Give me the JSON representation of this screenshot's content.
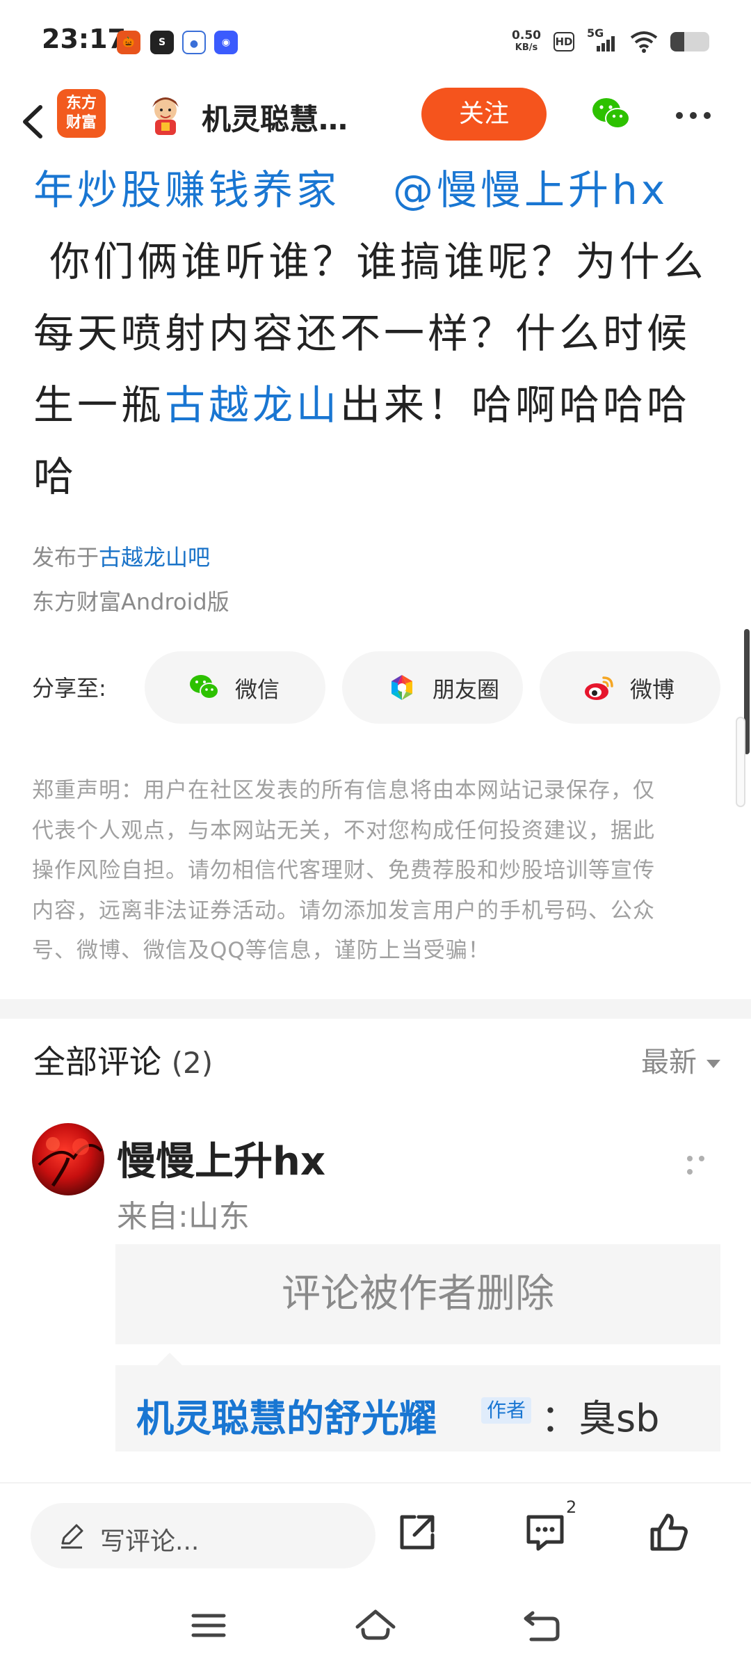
{
  "status_bar": {
    "time": "23:17",
    "net_speed_value": "0.50",
    "net_speed_unit": "KB/s",
    "hd": "HD",
    "signal": "5G",
    "battery_level": 0.35
  },
  "header": {
    "logo_line1": "东方",
    "logo_line2": "财富",
    "author_name": "机灵聪慧…",
    "follow_label": "关注"
  },
  "post": {
    "line1_a": "年炒股赚钱养家",
    "line1_b": "@慢慢上升hx",
    "line2": " 你们俩谁听谁？谁搞谁呢？为什么",
    "line3": "每天喷射内容还不一样？什么时候",
    "line4_a": "生一瓶",
    "line4_link": "古越龙山",
    "line4_b": "出来！哈啊哈哈哈",
    "line5": "哈",
    "published_prefix": "发布于",
    "published_forum": "古越龙山吧",
    "client": "东方财富Android版"
  },
  "share": {
    "label": "分享至:",
    "buttons": [
      {
        "label": "微信",
        "icon": "wechat-icon"
      },
      {
        "label": "朋友圈",
        "icon": "moments-icon"
      },
      {
        "label": "微博",
        "icon": "weibo-icon"
      }
    ]
  },
  "disclaimer_lines": [
    "郑重声明：用户在社区发表的所有信息将由本网站记录保存，仅",
    "代表个人观点，与本网站无关，不对您构成任何投资建议，据此",
    "操作风险自担。请勿相信代客理财、免费荐股和炒股培训等宣传",
    "内容，远离非法证券活动。请勿添加发言用户的手机号码、公众",
    "号、微博、微信及QQ等信息，谨防上当受骗！"
  ],
  "comments": {
    "title": "全部评论",
    "count": "(2)",
    "sort_label": "最新",
    "items": [
      {
        "name": "慢慢上升hx",
        "location": "来自:山东",
        "deleted_text": "评论被作者删除",
        "reply": {
          "name": "机灵聪慧的舒光耀",
          "author_tag": "作者",
          "text": "：臭sb"
        }
      }
    ]
  },
  "bottom_bar": {
    "write_placeholder": "写评论...",
    "comment_badge": "2"
  }
}
